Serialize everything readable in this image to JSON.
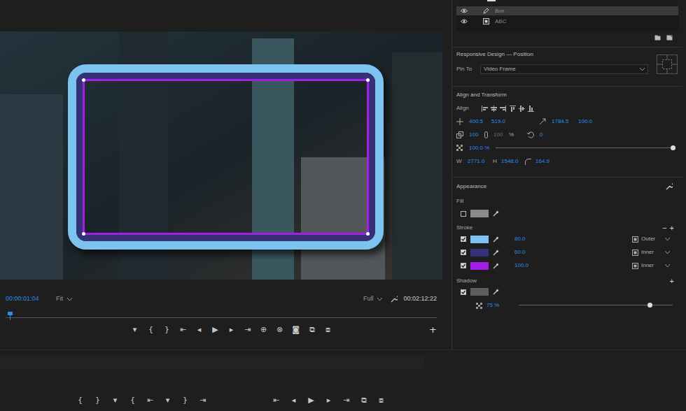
{
  "monitor": {
    "timecode": "00:00:01:04",
    "zoom": "Fit",
    "quality": "Full",
    "duration": "00:02:12:22",
    "playhead": 0.01,
    "transport": [
      "▾",
      "{",
      "}",
      "⇤",
      "◂",
      "▶",
      "▸",
      "⇥",
      "⊕",
      "⊗",
      "◙",
      "⧉",
      "⧈"
    ],
    "add": "+"
  },
  "bottom_transport": [
    "{",
    "}",
    "▾",
    "{",
    "⇤",
    "▾",
    "}",
    "⇥",
    "⇤",
    "◂",
    "▶",
    "▸",
    "⇥",
    "⧉",
    "⧈"
  ],
  "panel": {
    "layers": [
      {
        "name": "Box",
        "selected": true,
        "visible": true
      },
      {
        "name": "ABC",
        "selected": false,
        "visible": true
      }
    ],
    "responsive": {
      "title": "Responsive Design — Position",
      "pin_label": "Pin To",
      "pin_value": "Video Frame"
    },
    "transform": {
      "title": "Align and Transform",
      "align_label": "Align",
      "position_x": "400.5",
      "position_y": "519.0",
      "anchor_x": "1784.5",
      "anchor_y": "100.0",
      "scale_w": "100",
      "scale_h": "100",
      "scale_unit": "%",
      "rotation": "0",
      "opacity": "100.0 %",
      "opacity_level": 1,
      "w_label": "W",
      "width": "2771.0",
      "h_label": "H",
      "height": "1548.0",
      "radius": "164.9"
    },
    "appearance": {
      "title": "Appearance",
      "fill_label": "Fill",
      "fill_checked": false,
      "stroke_label": "Stroke",
      "stroke_buttons": [
        "−",
        "+"
      ],
      "strokes": [
        {
          "checked": true,
          "color": "#7cc4ef",
          "width": "80.0",
          "position": "Outer"
        },
        {
          "checked": true,
          "color": "#35307a",
          "width": "60.0",
          "position": "Inner"
        },
        {
          "checked": true,
          "color": "#a51ee6",
          "width": "100.0",
          "position": "Inner"
        }
      ],
      "shadow_label": "Shadow",
      "shadow_add": "+",
      "shadow_checked": true,
      "shadow_opacity": "75 %",
      "shadow_level": 0.85
    }
  }
}
